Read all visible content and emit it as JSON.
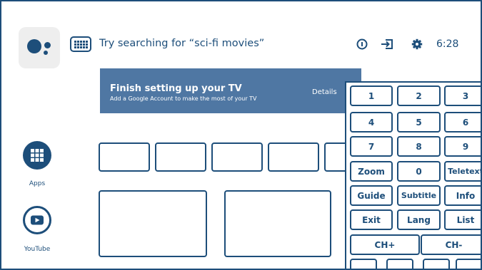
{
  "search": {
    "prompt": "Try searching for “sci-fi movies”"
  },
  "status": {
    "time": "6:28",
    "icons": [
      "info-icon",
      "input-icon",
      "settings-icon"
    ]
  },
  "banner": {
    "title": "Finish setting up your TV",
    "subtitle": "Add a Google Account to make the most of your TV",
    "details_label": "Details"
  },
  "sidebar": {
    "apps_label": "Apps",
    "youtube_label": "YouTube"
  },
  "remote": {
    "keys": {
      "k1": "1",
      "k2": "2",
      "k3": "3",
      "k4": "4",
      "k5": "5",
      "k6": "6",
      "k7": "7",
      "k8": "8",
      "k9": "9",
      "zoom": "Zoom",
      "k0": "0",
      "teletext": "Teletext",
      "guide": "Guide",
      "subtitle": "Subtitle",
      "info": "Info",
      "exit": "Exit",
      "lang": "Lang",
      "list": "List",
      "chplus": "CH+",
      "chminus": "CH-"
    }
  },
  "colors": {
    "accent": "#1d4e7a",
    "banner": "#4f77a3",
    "assistant_bg": "#eeeeee"
  }
}
